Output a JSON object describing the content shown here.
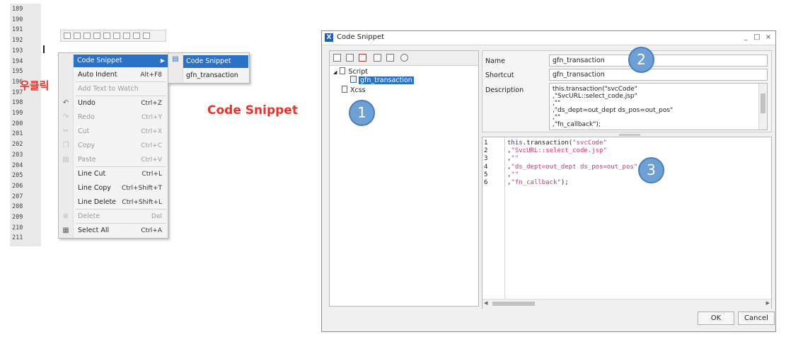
{
  "editor": {
    "line_numbers": [
      "189",
      "190",
      "191",
      "192",
      "193",
      "194",
      "195",
      "196",
      "197",
      "198",
      "199",
      "200",
      "201",
      "202",
      "203",
      "204",
      "205",
      "206",
      "207",
      "208",
      "209",
      "210",
      "211"
    ],
    "right_click_label": "우클릭",
    "caption": "Code Snippet"
  },
  "context_menu": {
    "items": [
      {
        "label": "Code Snippet",
        "shortcut": "",
        "highlighted": true,
        "disabled": false
      },
      {
        "label": "Auto Indent",
        "shortcut": "Alt+F8",
        "disabled": false
      },
      {
        "label": "Add Text to Watch",
        "shortcut": "",
        "disabled": true
      },
      {
        "label": "Undo",
        "shortcut": "Ctrl+Z",
        "disabled": false
      },
      {
        "label": "Redo",
        "shortcut": "Ctrl+Y",
        "disabled": true
      },
      {
        "label": "Cut",
        "shortcut": "Ctrl+X",
        "disabled": true
      },
      {
        "label": "Copy",
        "shortcut": "Ctrl+C",
        "disabled": true
      },
      {
        "label": "Paste",
        "shortcut": "Ctrl+V",
        "disabled": true
      },
      {
        "label": "Line Cut",
        "shortcut": "Ctrl+L",
        "disabled": false
      },
      {
        "label": "Line Copy",
        "shortcut": "Ctrl+Shift+T",
        "disabled": false
      },
      {
        "label": "Line Delete",
        "shortcut": "Ctrl+Shift+L",
        "disabled": false
      },
      {
        "label": "Delete",
        "shortcut": "Del",
        "disabled": true
      },
      {
        "label": "Select All",
        "shortcut": "Ctrl+A",
        "disabled": false
      }
    ]
  },
  "submenu": {
    "items": [
      {
        "label": "Code Snippet",
        "highlighted": true
      },
      {
        "label": "gfn_transaction",
        "highlighted": false
      }
    ]
  },
  "dialog": {
    "title": "Code Snippet",
    "tree": {
      "script": "Script",
      "snippet": "gfn_transaction",
      "xcss": "Xcss"
    },
    "props": {
      "name_label": "Name",
      "name_value": "gfn_transaction",
      "shortcut_label": "Shortcut",
      "shortcut_value": "gfn_transaction",
      "description_label": "Description",
      "description_lines": [
        "this.transaction(\"svcCode\"",
        ",\"SvcURL::select_code.jsp\"",
        ",\"\"",
        ",\"ds_dept=out_dept ds_pos=out_pos\"",
        ",\"\"",
        ",\"fn_callback\");"
      ]
    },
    "code_lines": [
      {
        "num": "1",
        "tokens": [
          {
            "t": "this",
            "c": "kw"
          },
          {
            "t": ".transaction(",
            "c": "plain"
          },
          {
            "t": "\"svcCode\"",
            "c": "str"
          }
        ]
      },
      {
        "num": "2",
        "tokens": [
          {
            "t": ",",
            "c": "plain"
          },
          {
            "t": "\"SvcURL::select_code.jsp\"",
            "c": "str"
          }
        ]
      },
      {
        "num": "3",
        "tokens": [
          {
            "t": ",",
            "c": "plain"
          },
          {
            "t": "\"\"",
            "c": "str"
          }
        ]
      },
      {
        "num": "4",
        "tokens": [
          {
            "t": ",",
            "c": "plain"
          },
          {
            "t": "\"ds_dept=out_dept ds_pos=out_pos\"",
            "c": "str"
          }
        ]
      },
      {
        "num": "5",
        "tokens": [
          {
            "t": ",",
            "c": "plain"
          },
          {
            "t": "\"\"",
            "c": "str"
          }
        ]
      },
      {
        "num": "6",
        "tokens": [
          {
            "t": ",",
            "c": "plain"
          },
          {
            "t": "\"fn_callback\"",
            "c": "str"
          },
          {
            "t": ");",
            "c": "plain"
          }
        ]
      }
    ],
    "markers": [
      "1",
      "2",
      "3"
    ],
    "ok_label": "OK",
    "cancel_label": "Cancel",
    "minimize": "_",
    "maximize": "□",
    "close": "×"
  },
  "colors": {
    "accent": "#2b72c7",
    "annotation_red": "#e8322a",
    "marker_blue": "#6da1d6"
  }
}
